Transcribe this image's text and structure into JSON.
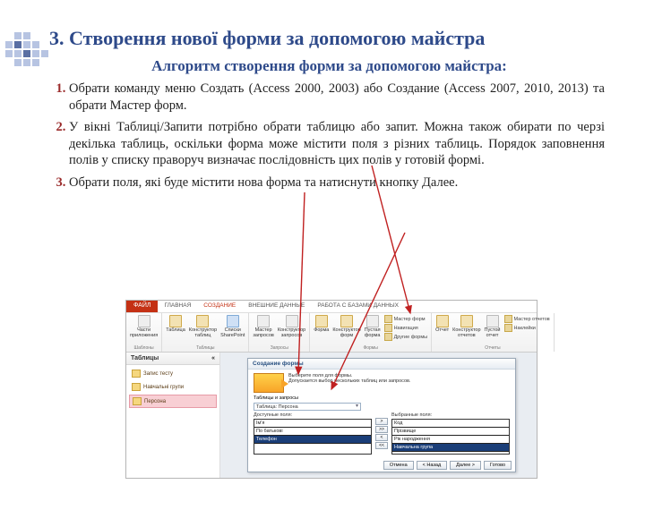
{
  "slide": {
    "title": "3. Створення нової форми за допомогою майстра",
    "subtitle": "Алгоритм створення форми за допомогою майстра:",
    "steps": [
      "Обрати команду меню Создать (Access 2000, 2003) або Создание (Access 2007, 2010, 2013) та обрати Мастер форм.",
      "У вікні Таблиці/Запити потрібно обрати таблицю або запит.  Можна також обирати по черзі декілька таблиць, оскільки форма може містити поля з різних таблиць. Порядок заповнення полів у списку праворуч визначає послідовність цих полів у готовій формі.",
      "Обрати поля, які буде містити нова форма та натиснути кнопку Далее."
    ]
  },
  "access": {
    "ribbon_tabs": {
      "file": "ФАЙЛ",
      "home": "ГЛАВНАЯ",
      "create": "СОЗДАНИЕ",
      "external": "ВНЕШНИЕ ДАННЫЕ",
      "dbtools": "РАБОТА С БАЗАМИ ДАННЫХ"
    },
    "ribbon_items": {
      "parts": "Части приложения",
      "table": "Таблица",
      "table_design": "Конструктор таблиц",
      "sp_lists": "Списки SharePoint",
      "query_wiz": "Мастер запросов",
      "query_design": "Конструктор запросов",
      "form": "Форма",
      "form_design": "Конструктор форм",
      "blank_form": "Пустая форма",
      "form_wizard": "Мастер форм",
      "navigation": "Навигация",
      "other_forms": "Другие формы",
      "report": "Отчет",
      "report_design": "Конструктор отчетов",
      "blank_report": "Пустой отчет",
      "report_wizard": "Мастер отчетов",
      "labels": "Наклейки"
    },
    "ribbon_groups": {
      "templates": "Шаблоны",
      "tables": "Таблицы",
      "queries": "Запросы",
      "forms": "Формы",
      "reports": "Отчеты"
    },
    "nav": {
      "header": "Таблицы",
      "items": [
        "Запис тесту",
        "Навчальні групи",
        "Персона"
      ]
    },
    "wizard": {
      "title": "Создание формы",
      "line1": "Выберите поля для формы.",
      "line2": "Допускается выбор нескольких таблиц или запросов.",
      "tables_lbl": "Таблицы и запросы",
      "combo_value": "Таблица: Персона",
      "avail_lbl": "Доступные поля:",
      "sel_lbl": "Выбранные поля:",
      "avail": [
        "Ім'я",
        "По батькові",
        "Телефон"
      ],
      "selected": [
        "Код",
        "Прізвище",
        "Рік народження",
        "Навчальна група"
      ],
      "btn_cancel": "Отмена",
      "btn_back": "< Назад",
      "btn_next": "Далее >",
      "btn_finish": "Готово"
    }
  }
}
